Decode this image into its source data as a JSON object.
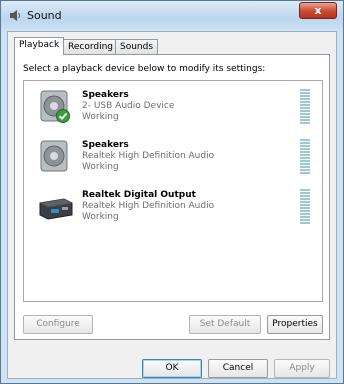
{
  "window": {
    "title": "Sound",
    "close_glyph": "x"
  },
  "tabs": [
    {
      "label": "Playback",
      "active": true
    },
    {
      "label": "Recording",
      "active": false
    },
    {
      "label": "Sounds",
      "active": false
    }
  ],
  "playback": {
    "instruction": "Select a playback device below to modify its settings:",
    "devices": [
      {
        "name": "Speakers",
        "description": "2- USB Audio Device",
        "status": "Working",
        "icon": "speaker-icon",
        "is_default": true
      },
      {
        "name": "Speakers",
        "description": "Realtek High Definition Audio",
        "status": "Working",
        "icon": "speaker-icon",
        "is_default": false
      },
      {
        "name": "Realtek Digital Output",
        "description": "Realtek High Definition Audio",
        "status": "Working",
        "icon": "digital-output-icon",
        "is_default": false
      }
    ],
    "buttons": {
      "configure": "Configure",
      "set_default": "Set Default",
      "properties": "Properties"
    }
  },
  "footer": {
    "ok": "OK",
    "cancel": "Cancel",
    "apply": "Apply"
  },
  "colors": {
    "titlebar": "#c8ddf1",
    "close": "#c74a33",
    "meter": "#9ec8d8",
    "check": "#3aa03a"
  }
}
